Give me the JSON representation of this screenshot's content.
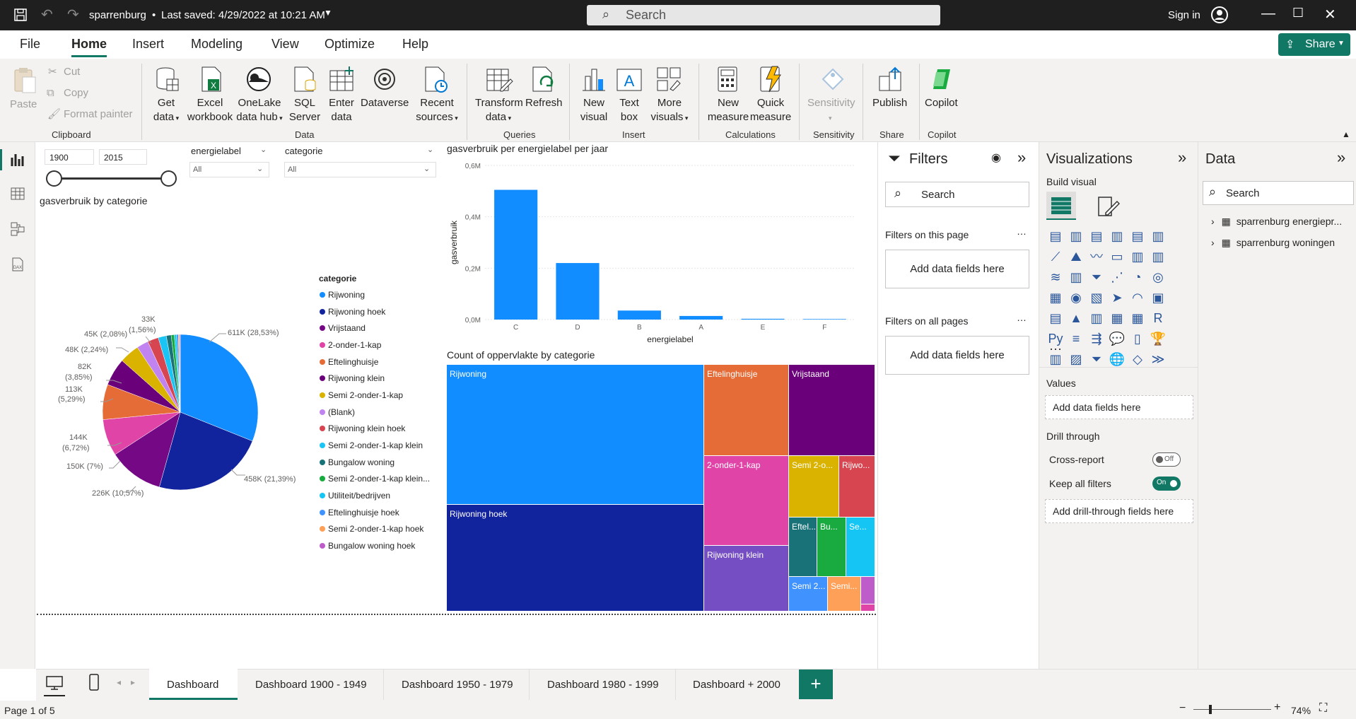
{
  "titlebar": {
    "doc": "sparrenburg",
    "saved": "Last saved: 4/29/2022 at 10:21 AM",
    "search": "Search",
    "signin": "Sign in"
  },
  "menu": [
    "File",
    "Home",
    "Insert",
    "Modeling",
    "View",
    "Optimize",
    "Help"
  ],
  "share": "Share",
  "ribbon": {
    "clipboard": {
      "paste": "Paste",
      "cut": "Cut",
      "copy": "Copy",
      "format_painter": "Format painter",
      "group": "Clipboard"
    },
    "data": {
      "get_data": [
        "Get",
        "data"
      ],
      "excel": [
        "Excel",
        "workbook"
      ],
      "onelake": [
        "OneLake",
        "data hub"
      ],
      "sql": [
        "SQL",
        "Server"
      ],
      "enter": [
        "Enter",
        "data"
      ],
      "dataverse": "Dataverse",
      "recent": [
        "Recent",
        "sources"
      ],
      "group": "Data"
    },
    "queries": {
      "transform": [
        "Transform",
        "data"
      ],
      "refresh": "Refresh",
      "group": "Queries"
    },
    "insert": {
      "new_visual": [
        "New",
        "visual"
      ],
      "text_box": [
        "Text",
        "box"
      ],
      "more_visuals": [
        "More",
        "visuals"
      ],
      "group": "Insert"
    },
    "calculations": {
      "new_measure": [
        "New",
        "measure"
      ],
      "quick_measure": [
        "Quick",
        "measure"
      ],
      "group": "Calculations"
    },
    "sensitivity": {
      "label": "Sensitivity",
      "group": "Sensitivity"
    },
    "share": {
      "publish": "Publish",
      "group": "Share"
    },
    "copilot": {
      "label": "Copilot",
      "group": "Copilot"
    }
  },
  "slicers": {
    "year_from": "1900",
    "year_to": "2015",
    "energielabel": {
      "title": "energielabel",
      "value": "All"
    },
    "categorie": {
      "title": "categorie",
      "value": "All"
    }
  },
  "pie": {
    "title": "gasverbruik by categorie",
    "legend_title": "categorie",
    "labels": [
      "611K (28,53%)",
      "458K (21,39%)",
      "226K (10,57%)",
      "150K (7%)",
      "144K",
      "(6,72%)",
      "113K",
      "(5,29%)",
      "82K",
      "(3,85%)",
      "48K (2,24%)",
      "45K (2,08%)",
      "33K",
      "(1,56%)"
    ]
  },
  "bar_title": "gasverbruik per energielabel per jaar",
  "treemap": {
    "title": "Count of oppervlakte by categorie",
    "labels": [
      "Rijwoning",
      "Rijwoning hoek",
      "Eftelinghuisje",
      "Vrijstaand",
      "2-onder-1-kap",
      "Semi 2-o...",
      "Rijwo...",
      "Rijwoning klein",
      "Eftel...",
      "Bu...",
      "Se...",
      "Semi 2...",
      "Semi..."
    ]
  },
  "chart_data": [
    {
      "type": "pie",
      "title": "gasverbruik by categorie",
      "legend_title": "categorie",
      "categories": [
        "Rijwoning",
        "Rijwoning hoek",
        "Vrijstaand",
        "2-onder-1-kap",
        "Eftelinghuisje",
        "Rijwoning klein",
        "Semi 2-onder-1-kap",
        "(Blank)",
        "Rijwoning klein hoek",
        "Semi 2-onder-1-kap klein",
        "Bungalow woning",
        "Semi 2-onder-1-kap klein...",
        "Utiliteit/bedrijven",
        "Eftelinghuisje hoek",
        "Semi 2-onder-1-kap hoek",
        "Bungalow woning hoek"
      ],
      "values": [
        611000,
        458000,
        226000,
        150000,
        144000,
        113000,
        82000,
        48000,
        45000,
        33000,
        20000,
        13000,
        9000,
        7000,
        5000,
        3000
      ],
      "colors": [
        "#118dff",
        "#12239e",
        "#750985",
        "#e044a7",
        "#e66c37",
        "#6b007b",
        "#d9b300",
        "#c083f0",
        "#d64550",
        "#1ac5f5",
        "#197278",
        "#1aab40",
        "#15c6f4",
        "#4092ff",
        "#ffa058",
        "#be5dc9"
      ]
    },
    {
      "type": "bar",
      "title": "gasverbruik per energielabel per jaar",
      "xlabel": "energielabel",
      "ylabel": "gasverbruik",
      "categories": [
        "C",
        "D",
        "B",
        "A",
        "E",
        "F"
      ],
      "values": [
        505000,
        220000,
        35000,
        14000,
        3000,
        2000
      ],
      "y_ticks": [
        "0,0M",
        "0,2M",
        "0,4M",
        "0,6M"
      ],
      "ylim": [
        0,
        600000
      ],
      "color": "#118dff"
    },
    {
      "type": "treemap",
      "title": "Count of oppervlakte by categorie",
      "categories": [
        "Rijwoning",
        "Rijwoning hoek",
        "Eftelinghuisje",
        "Vrijstaand",
        "2-onder-1-kap",
        "Semi 2-onder-1-kap",
        "Rijwoning klein hoek",
        "Rijwoning klein",
        "Eftelinghuisje hoek",
        "Bungalow woning",
        "Semi 2-onder-1-kap klein",
        "Semi 2-onder-1-kap klein...",
        "Semi 2-onder-1-kap hoek",
        "Bungalow woning hoek",
        "Utiliteit/bedrijven"
      ]
    }
  ],
  "filters": {
    "title": "Filters",
    "search": "Search",
    "this_page": "Filters on this page",
    "add1": "Add data fields here",
    "all_pages": "Filters on all pages",
    "add2": "Add data fields here"
  },
  "viz": {
    "title": "Visualizations",
    "build": "Build visual",
    "values": "Values",
    "add_values": "Add data fields here",
    "drill": "Drill through",
    "cross": "Cross-report",
    "cross_state": "Off",
    "keep": "Keep all filters",
    "keep_state": "On",
    "add_drill": "Add drill-through fields here"
  },
  "data": {
    "title": "Data",
    "search": "Search",
    "tables": [
      "sparrenburg energiepr...",
      "sparrenburg woningen"
    ]
  },
  "tabs": [
    "Dashboard",
    "Dashboard 1900 - 1949",
    "Dashboard 1950 - 1979",
    "Dashboard 1980 - 1999",
    "Dashboard + 2000"
  ],
  "status": {
    "page": "Page 1 of 5",
    "zoom": "74%"
  }
}
